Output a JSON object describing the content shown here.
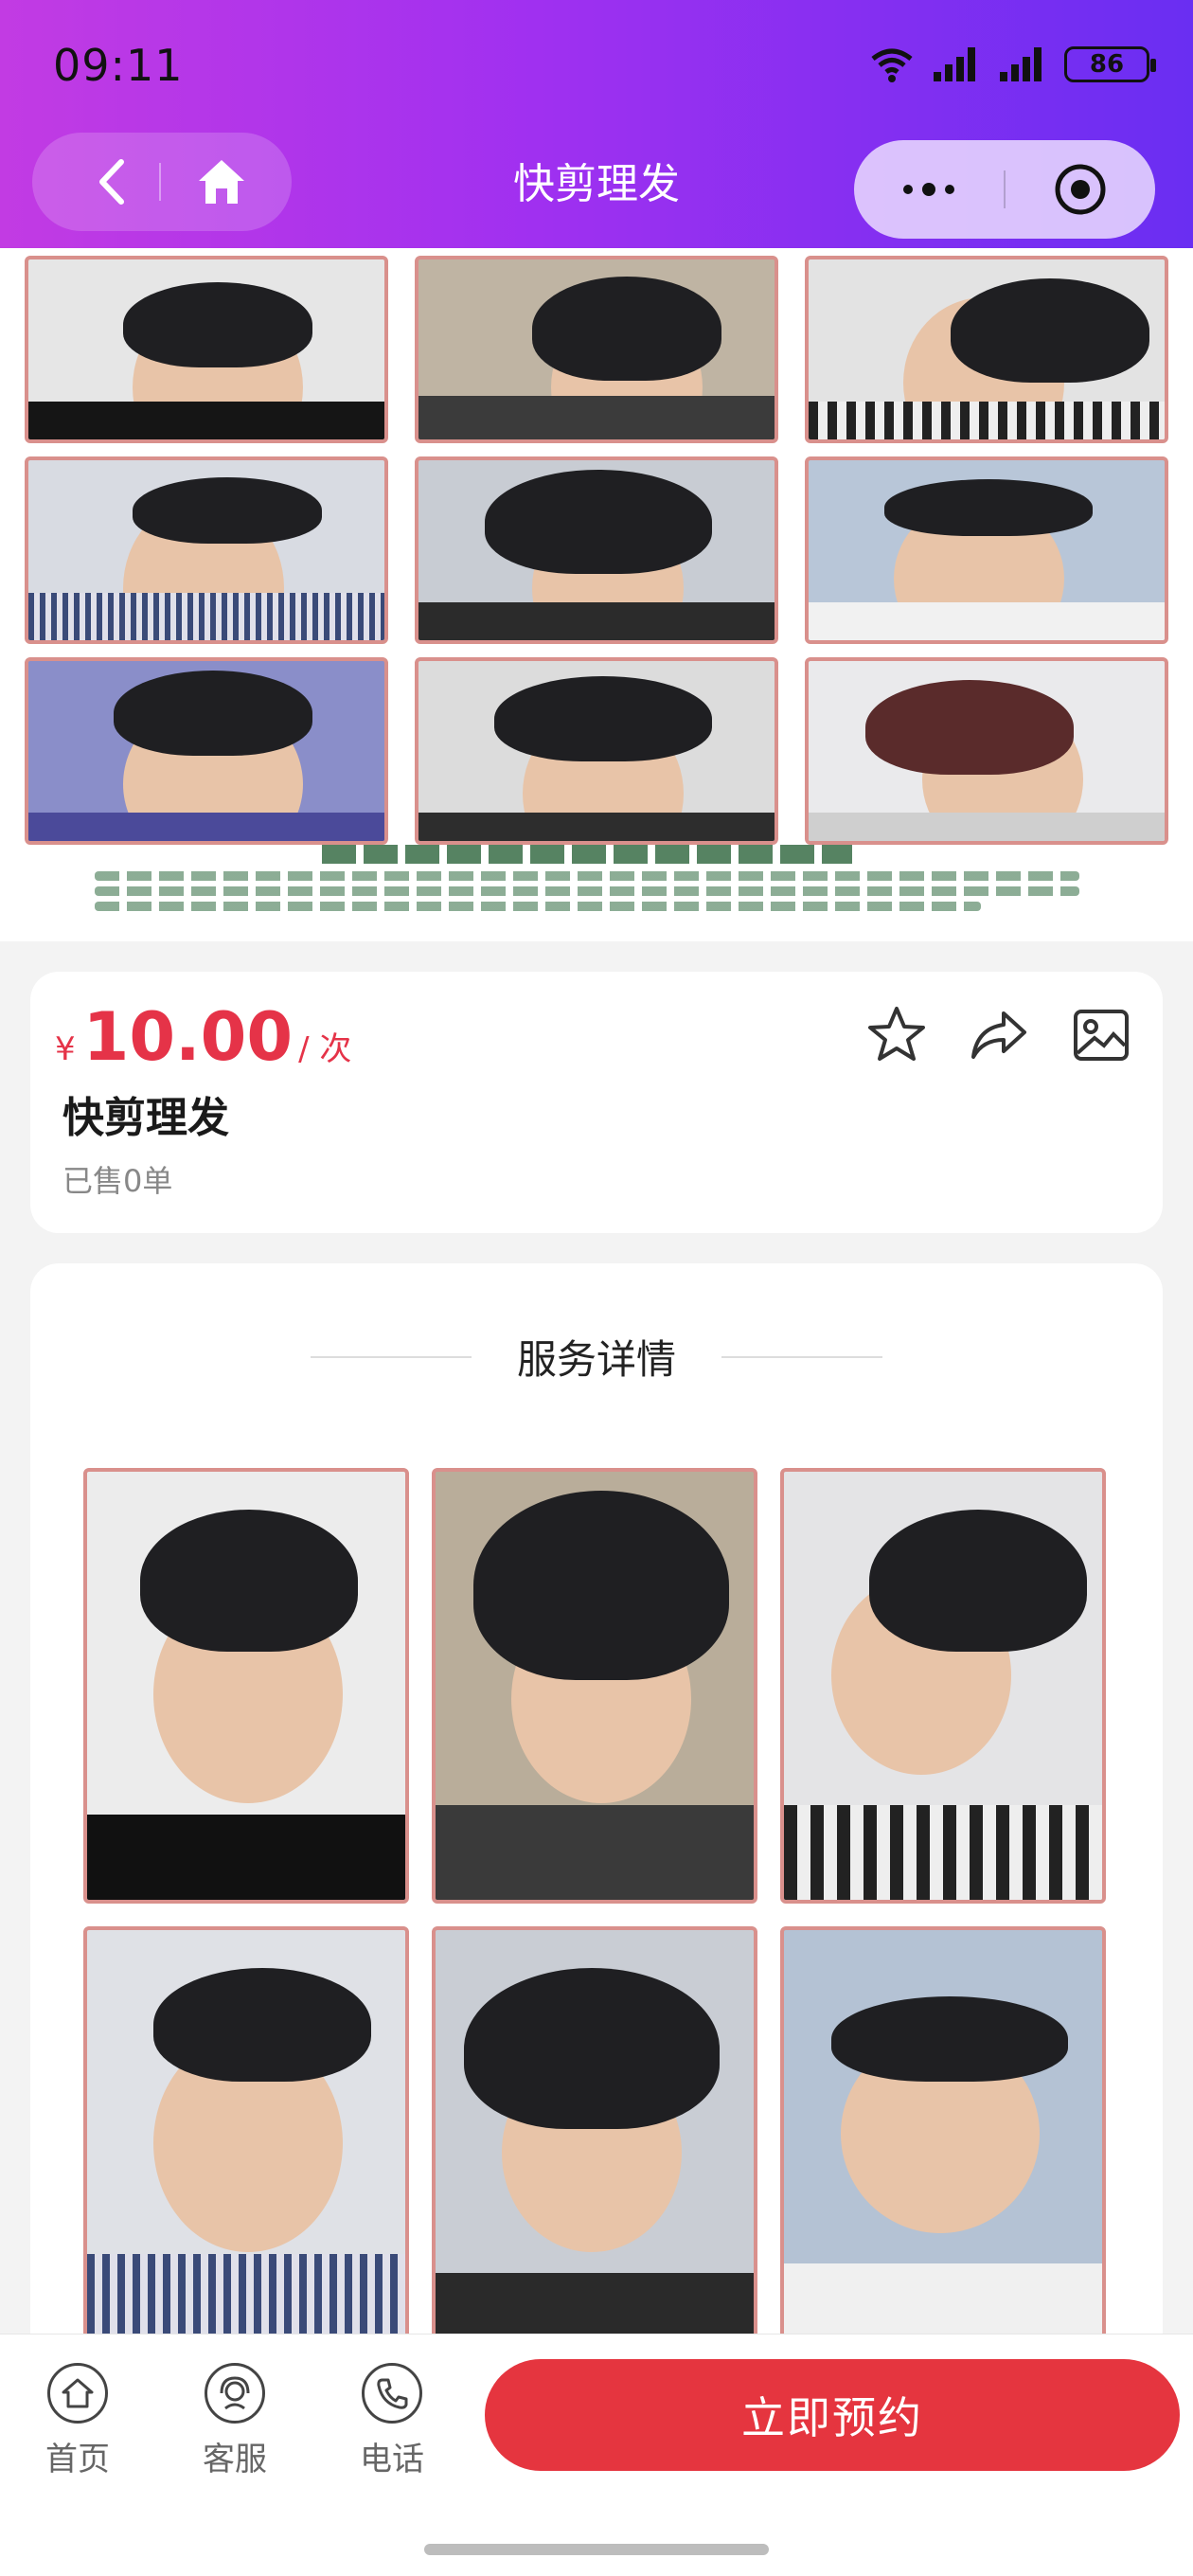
{
  "status_bar": {
    "time": "09:11",
    "battery": "86"
  },
  "nav": {
    "title": "快剪理发"
  },
  "product": {
    "currency": "¥",
    "price": "10.00",
    "unit": "/ 次",
    "title": "快剪理发",
    "sold": "已售0单"
  },
  "details": {
    "heading": "服务详情"
  },
  "bottom_bar": {
    "tabs": [
      {
        "label": "首页"
      },
      {
        "label": "客服"
      },
      {
        "label": "电话"
      }
    ],
    "book_label": "立即预约"
  },
  "colors": {
    "accent": "#e5353f",
    "price": "#e53348",
    "header_start": "#c23be3",
    "header_end": "#6a2ef2"
  }
}
